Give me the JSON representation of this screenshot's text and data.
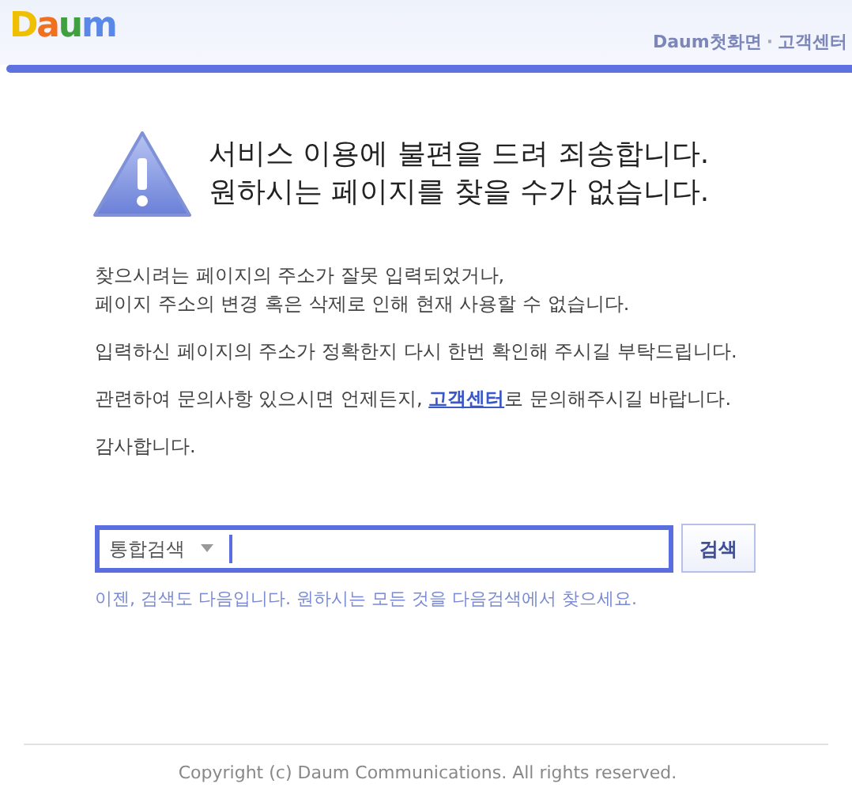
{
  "header": {
    "logo": "Daum",
    "links": [
      "Daum첫화면",
      "고객센터"
    ],
    "separator": "·"
  },
  "headline": [
    "서비스 이용에 불편을 드려 죄송합니다.",
    "원하시는 페이지를 찾을 수가 없습니다."
  ],
  "paragraphs": [
    {
      "parts": [
        {
          "kind": "text",
          "text": "찾으시려는 페이지의 주소가 잘못 입력되었거나,"
        }
      ]
    },
    {
      "parts": [
        {
          "kind": "text",
          "text": "페이지 주소의 변경 혹은 삭제로 인해 현재 사용할 수 없습니다."
        }
      ]
    },
    {
      "parts": [
        {
          "kind": "text",
          "text": "입력하신 페이지의 주소가 정확한지 다시 한번 확인해 주시길 부탁드립니다."
        }
      ]
    },
    {
      "parts": [
        {
          "kind": "text",
          "text": "관련하여 문의사항 있으시면 언제든지, "
        },
        {
          "kind": "link",
          "text": "고객센터"
        },
        {
          "kind": "text",
          "text": "로 문의해주시길 바랍니다."
        }
      ]
    },
    {
      "parts": [
        {
          "kind": "text",
          "text": "감사합니다."
        }
      ]
    }
  ],
  "search": {
    "category": "통합검색",
    "button": "검색",
    "hint": "이젠, 검색도 다음입니다. 원하시는 모든 것을 다음검색에서 찾으세요."
  },
  "footer": {
    "copyright": "Copyright (c) Daum Communications. All rights reserved."
  }
}
